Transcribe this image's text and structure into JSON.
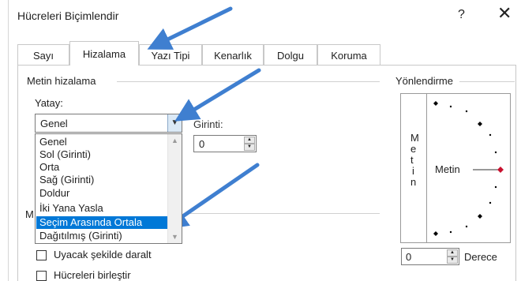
{
  "dialog": {
    "title": "Hücreleri Biçimlendir",
    "help_label": "?",
    "close_label": "✕"
  },
  "tabs": [
    {
      "label": "Sayı",
      "active": false
    },
    {
      "label": "Hizalama",
      "active": true
    },
    {
      "label": "Yazı Tipi",
      "active": false
    },
    {
      "label": "Kenarlık",
      "active": false
    },
    {
      "label": "Dolgu",
      "active": false
    },
    {
      "label": "Koruma",
      "active": false
    }
  ],
  "text_alignment": {
    "group_label": "Metin hizalama",
    "horizontal_label": "Yatay:",
    "horizontal_value": "Genel",
    "indent_label": "Girinti:",
    "indent_value": "0",
    "options": [
      "Genel",
      "Sol (Girinti)",
      "Orta",
      "Sağ (Girinti)",
      "Doldur",
      "İki Yana Yasla",
      "Seçim Arasında Ortala",
      "Dağıtılmış (Girinti)"
    ],
    "highlighted_option": "Seçim Arasında Ortala",
    "partial_label": "M"
  },
  "text_control": {
    "shrink_label": "Uyacak şekilde daralt",
    "merge_label": "Hücreleri birleştir"
  },
  "orientation": {
    "group_label": "Yönlendirme",
    "vertical_letters": [
      "M",
      "e",
      "t",
      "i",
      "n"
    ],
    "dial_label": "Metin",
    "degree_value": "0",
    "degree_label": "Derece"
  },
  "annotations": {
    "arrow_color": "#3f7fd0",
    "highlight_color": "#0078d7"
  }
}
